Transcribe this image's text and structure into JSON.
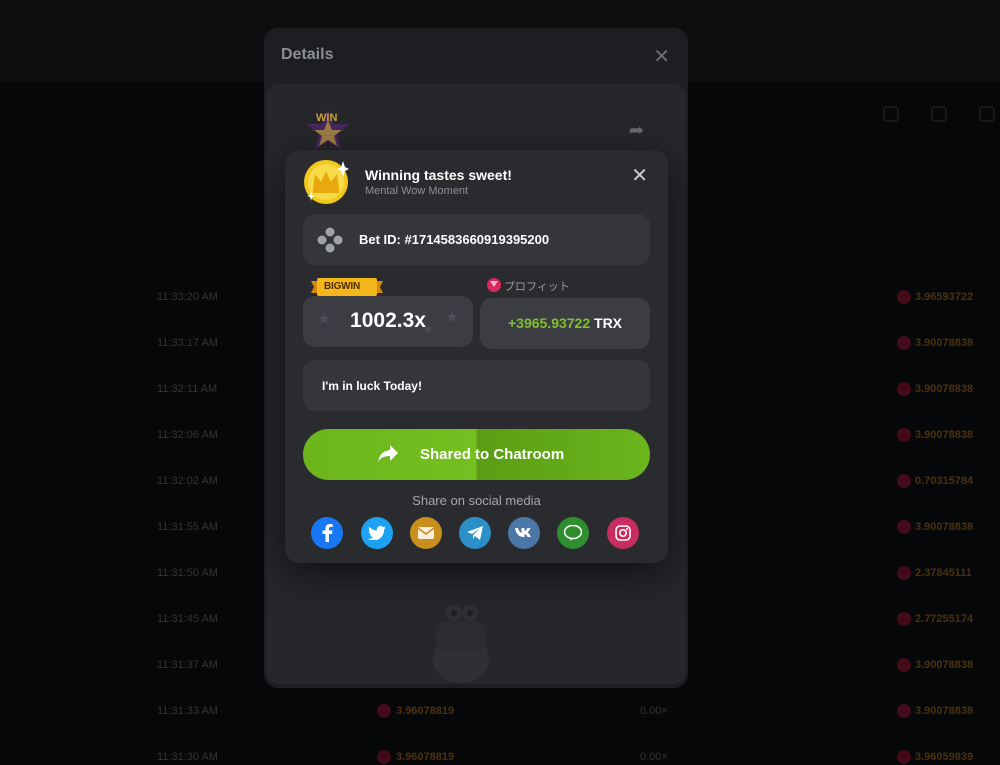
{
  "details": {
    "title": "Details",
    "close": "✕",
    "win_badge": "WIN"
  },
  "background": {
    "rows": [
      {
        "time": "11:33:20 AM",
        "value": "3.96593722"
      },
      {
        "time": "11:33:17 AM",
        "value": "3.90078838"
      },
      {
        "time": "11:32:11 AM",
        "value": "3.90078838"
      },
      {
        "time": "11:32:06 AM",
        "value": "3.90078838"
      },
      {
        "time": "11:32:02 AM",
        "value": "0.70315784"
      },
      {
        "time": "11:31:55 AM",
        "value": "3.90078838"
      },
      {
        "time": "11:31:50 AM",
        "value": "2.37845111"
      },
      {
        "time": "11:31:45 AM",
        "value": "2.77255174"
      },
      {
        "time": "11:31:37 AM",
        "value": "3.90078838"
      },
      {
        "time": "11:31:33 AM",
        "value": "3.90078838",
        "mid_value": "3.96078819",
        "mid_x": "0.00×"
      },
      {
        "time": "11:31:30 AM",
        "value": "3.96059839",
        "mid_value": "3.96078819",
        "mid_x": "0.00×"
      }
    ]
  },
  "modal": {
    "title": "Winning tastes sweet!",
    "subtitle": "Mental Wow Moment",
    "close": "✕",
    "bet_id": "Bet ID: #1714583660919395200",
    "bigwin_label": "BIGWIN",
    "multiplier": "1002.3x",
    "profit_label": "プロフィット",
    "profit_amount": "+3965.93722",
    "profit_currency": "TRX",
    "message": "I'm in luck Today!",
    "share_button": "Shared to Chatroom",
    "social_caption": "Share on social media",
    "social": [
      {
        "icon": "facebook-icon",
        "color": "#1877f2"
      },
      {
        "icon": "twitter-icon",
        "color": "#1da1f2"
      },
      {
        "icon": "email-icon",
        "color": "#e0a52a"
      },
      {
        "icon": "telegram-icon",
        "color": "#2ca5e0"
      },
      {
        "icon": "vk-icon",
        "color": "#4a76a8"
      },
      {
        "icon": "line-icon",
        "color": "#3aae3a"
      },
      {
        "icon": "instagram-icon",
        "color": "#d6336c"
      }
    ]
  }
}
